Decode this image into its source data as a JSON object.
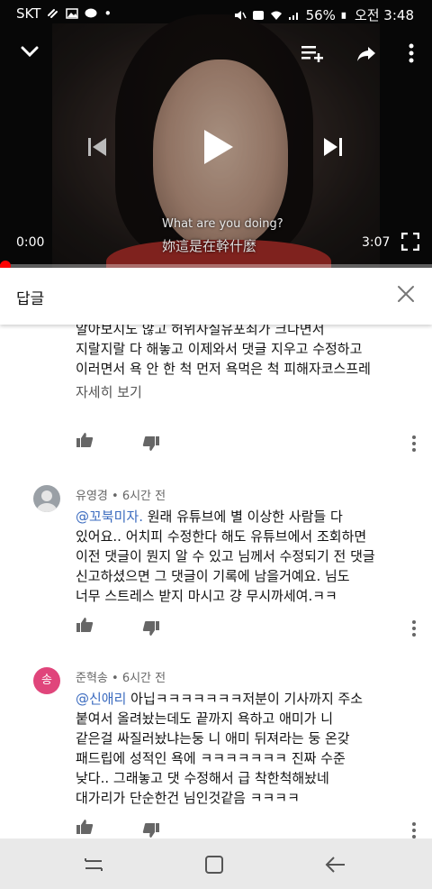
{
  "status_bar": {
    "carrier": "SKT",
    "battery": "56%",
    "time": "오전 3:48"
  },
  "video": {
    "elapsed": "0:00",
    "duration": "3:07",
    "progress": 0.0,
    "subtitle_en": "What are you doing?",
    "subtitle_cn": "妳這是在幹什麼"
  },
  "replies": {
    "title": "답글"
  },
  "comments": [
    {
      "text": "알아보지도 않고 허위사실유포죄가 크다면서\n지랄지랄 다 해놓고 이제와서 댓글 지우고 수정하고\n이러면서 욕 안 한 척 먼저 욕먹은 척 피해자코스프레",
      "read_more": "자세히 보기"
    },
    {
      "author": "유영경",
      "time": "6시간 전",
      "mention": "@꼬북미자.",
      "text": " 원래 유튜브에 별 이상한 사람들 다\n있어요.. 어치피 수정한다 해도 유튜브에서 조회하면\n이전 댓글이 뭔지 알 수 있고 님께서 수정되기 전 댓글\n신고하셨으면 그 댓글이 기록에 남을거예요. 님도\n너무 스트레스 받지 마시고 걍 무시까세여.ㅋㅋ"
    },
    {
      "author": "준혁송",
      "avatar_letter": "송",
      "time": "6시간 전",
      "mention": "@신애리",
      "text": " 아닙ㅋㅋㅋㅋㅋㅋㅋ저분이 기사까지 주소\n붙여서 올려놨는데도 끝까지 욕하고 애미가 니\n같은걸 싸질러놨냐는둥 니 애미 뒤져라는 둥 온갖\n패드립에 성적인 욕에 ㅋㅋㅋㅋㅋㅋㅋ 진짜 수준\n낮다.. 그래놓고 댓 수정해서 급 착한척해놨네\n대가리가 단순한건 님인것같음 ㅋㅋㅋㅋ"
    }
  ],
  "colors": {
    "progress": "#ff0000",
    "mention": "#3b6bbf",
    "avatar_pink": "#e0457b",
    "avatar_gray": "#9aa0a6"
  }
}
